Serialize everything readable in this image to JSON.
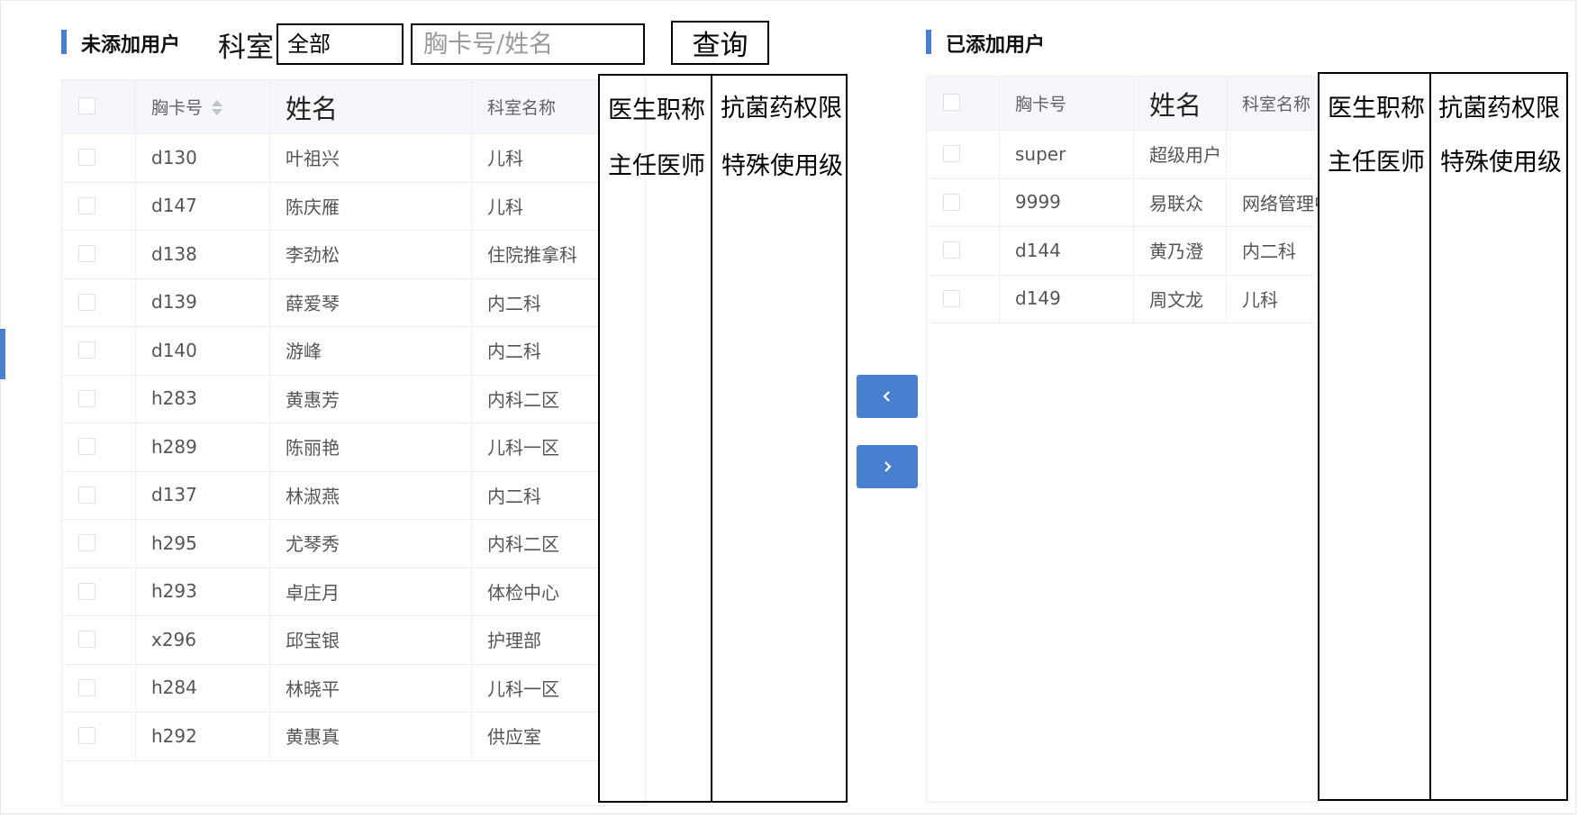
{
  "left": {
    "title": "未添加用户",
    "dept_label": "科室",
    "dept_value": "全部",
    "search_placeholder": "胸卡号/姓名",
    "query_label": "查询",
    "headers": {
      "card": "胸卡号",
      "name": "姓名",
      "dept": "科室名称",
      "title": "医生职称",
      "perm": "抗菌药权限"
    },
    "first_row_extra": {
      "title": "主任医师",
      "perm": "特殊使用级"
    },
    "rows": [
      {
        "card": "d130",
        "name": "叶祖兴",
        "dept": "儿科"
      },
      {
        "card": "d147",
        "name": "陈庆雁",
        "dept": "儿科"
      },
      {
        "card": "d138",
        "name": "李劲松",
        "dept": "住院推拿科"
      },
      {
        "card": "d139",
        "name": "薛爱琴",
        "dept": "内二科"
      },
      {
        "card": "d140",
        "name": "游峰",
        "dept": "内二科"
      },
      {
        "card": "h283",
        "name": "黄惠芳",
        "dept": "内科二区"
      },
      {
        "card": "h289",
        "name": "陈丽艳",
        "dept": "儿科一区"
      },
      {
        "card": "d137",
        "name": "林淑燕",
        "dept": "内二科"
      },
      {
        "card": "h295",
        "name": "尤琴秀",
        "dept": "内科二区"
      },
      {
        "card": "h293",
        "name": "卓庄月",
        "dept": "体检中心"
      },
      {
        "card": "x296",
        "name": "邱宝银",
        "dept": "护理部"
      },
      {
        "card": "h284",
        "name": "林晓平",
        "dept": "儿科一区"
      },
      {
        "card": "h292",
        "name": "黄惠真",
        "dept": "供应室"
      }
    ]
  },
  "right": {
    "title": "已添加用户",
    "headers": {
      "card": "胸卡号",
      "name": "姓名",
      "dept": "科室名称",
      "title": "医生职称",
      "perm": "抗菌药权限"
    },
    "first_row_extra": {
      "title": "主任医师",
      "perm": "特殊使用级"
    },
    "rows": [
      {
        "card": "super",
        "name": "超级用户",
        "dept": ""
      },
      {
        "card": "9999",
        "name": "易联众",
        "dept": "网络管理中心"
      },
      {
        "card": "d144",
        "name": "黄乃澄",
        "dept": "内二科"
      },
      {
        "card": "d149",
        "name": "周文龙",
        "dept": "儿科"
      }
    ]
  },
  "transfer": {
    "left_icon": "chevron-left-icon",
    "right_icon": "chevron-right-icon"
  },
  "colors": {
    "accent": "#4a7fcf",
    "header_bg": "#f5f7fa",
    "border": "#ebeef5"
  }
}
